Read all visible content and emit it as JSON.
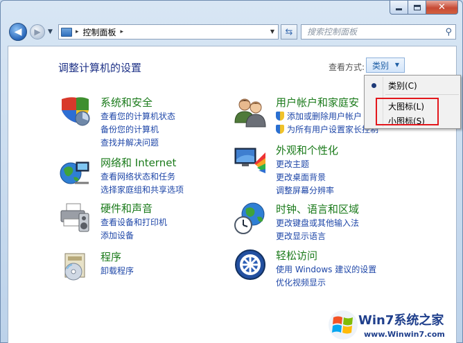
{
  "window": {
    "caption": {
      "minimize": "",
      "maximize": "",
      "close": "✕"
    }
  },
  "nav": {
    "back_glyph": "◀",
    "forward_glyph": "▶",
    "address": {
      "separator": "▸",
      "path": "控制面板",
      "separator2": "▸",
      "dropdown_glyph": "▼"
    },
    "refresh_glyph": "⇆",
    "search_placeholder": "搜索控制面板",
    "search_glyph": "⚲"
  },
  "content": {
    "title": "调整计算机的设置",
    "view_label": "查看方式:",
    "view_value": "类别",
    "view_arrow": "▼"
  },
  "categories": [
    {
      "id": "system-security",
      "title": "系统和安全",
      "links": [
        "查看您的计算机状态",
        "备份您的计算机",
        "查找并解决问题"
      ]
    },
    {
      "id": "user-accounts",
      "title": "用户帐户和家庭安",
      "links": [
        "添加或删除用户帐户",
        "为所有用户设置家长控制"
      ]
    },
    {
      "id": "network-internet",
      "title": "网络和 Internet",
      "links": [
        "查看网络状态和任务",
        "选择家庭组和共享选项"
      ]
    },
    {
      "id": "appearance",
      "title": "外观和个性化",
      "links": [
        "更改主题",
        "更改桌面背景",
        "调整屏幕分辨率"
      ]
    },
    {
      "id": "hardware-sound",
      "title": "硬件和声音",
      "links": [
        "查看设备和打印机",
        "添加设备"
      ]
    },
    {
      "id": "clock-language",
      "title": "时钟、语言和区域",
      "links": [
        "更改键盘或其他输入法",
        "更改显示语言"
      ]
    },
    {
      "id": "programs",
      "title": "程序",
      "links": [
        "卸载程序"
      ]
    },
    {
      "id": "ease-of-access",
      "title": "轻松访问",
      "links": [
        "使用 Windows 建议的设置",
        "优化视频显示"
      ]
    }
  ],
  "view_menu": {
    "items": [
      "类别(C)",
      "大图标(L)",
      "小图标(S)"
    ],
    "selected": 0
  },
  "watermark": {
    "brand": "Win7系统之家",
    "url": "www.Winwin7.com"
  },
  "icons": {
    "back": "back-arrow-icon",
    "forward": "forward-arrow-icon",
    "control_panel": "control-panel-icon",
    "refresh": "refresh-icon",
    "search": "search-icon"
  }
}
